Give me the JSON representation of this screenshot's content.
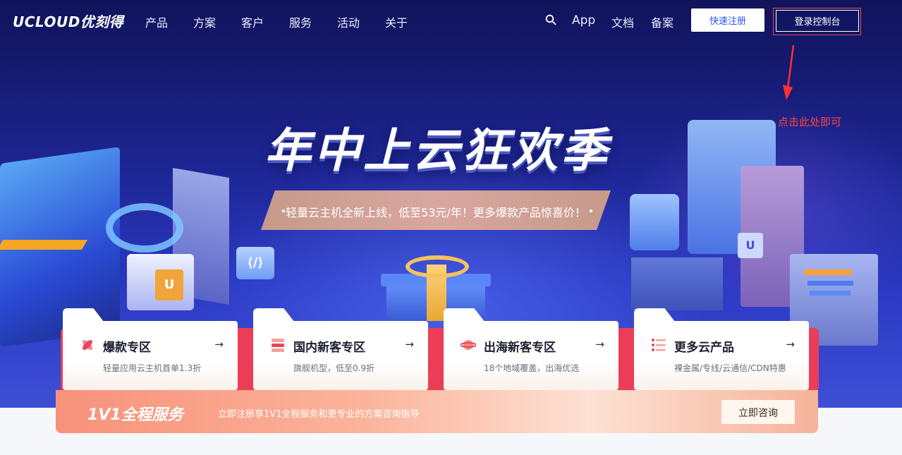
{
  "nav": {
    "logo": "UCLOUD优刻得",
    "items": [
      "产品",
      "方案",
      "客户",
      "服务",
      "活动",
      "关于"
    ],
    "right_items": [
      "App",
      "文档",
      "备案"
    ],
    "register_label": "快速注册",
    "console_label": "登录控制台"
  },
  "annotation": {
    "text": "点击此处即可"
  },
  "hero": {
    "headline": "年中上云狂欢季",
    "promo": "轻量云主机全新上线，低至53元/年！更多爆款产品惊喜价！",
    "u_badge_left": "U",
    "u_badge_right": "U",
    "code_cube": "⟨/⟩"
  },
  "cards": [
    {
      "title": "爆款专区",
      "subtitle": "轻量应用云主机首单1.3折",
      "icon": "flower-icon",
      "arrow": "→"
    },
    {
      "title": "国内新客专区",
      "subtitle": "旗舰机型，低至0.9折",
      "icon": "stack-icon",
      "arrow": "→"
    },
    {
      "title": "出海新客专区",
      "subtitle": "18个地域覆盖，出海优选",
      "icon": "planet-icon",
      "arrow": "→"
    },
    {
      "title": "更多云产品",
      "subtitle": "裸金属/专线/云通信/CDN特惠",
      "icon": "list-icon",
      "arrow": "→"
    }
  ],
  "service": {
    "title": "1V1全程服务",
    "description": "立即注册享1V1全程服务和更专业的方案咨询指导",
    "button_label": "立即咨询"
  },
  "colors": {
    "accent_blue": "#2d54f0",
    "annotation_red": "#ff4040",
    "strip_red": "#ec3d58"
  }
}
